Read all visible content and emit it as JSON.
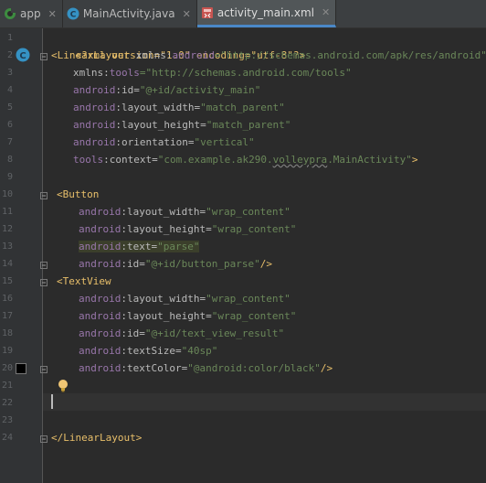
{
  "tabs": [
    {
      "label": "app",
      "icon": "android-module-icon",
      "active": false
    },
    {
      "label": "MainActivity.java",
      "icon": "class-icon",
      "active": false
    },
    {
      "label": "activity_main.xml",
      "icon": "xml-layout-icon",
      "active": true
    }
  ],
  "tab_close_glyph": "✕",
  "line_numbers": [
    "1",
    "2",
    "3",
    "4",
    "5",
    "6",
    "7",
    "8",
    "9",
    "10",
    "11",
    "12",
    "13",
    "14",
    "15",
    "16",
    "17",
    "18",
    "19",
    "20",
    "21",
    "22",
    "23",
    "24"
  ],
  "gutter_class_marker": "C",
  "code": {
    "l1": {
      "text": "<?xml version=\"1.0\" encoding=\"utf-8\"?>"
    },
    "l2": {
      "open": "<LinearLayout",
      "a1": " xmlns:",
      "a1ns": "android",
      "v1": "=\"http://schemas.android.com/apk/res/android\""
    },
    "l3": {
      "a": "xmlns:",
      "ns": "tools",
      "v": "=\"http://schemas.android.com/tools\""
    },
    "l4": {
      "ns": "android",
      "a": ":id=",
      "v": "\"@+id/activity_main\""
    },
    "l5": {
      "ns": "android",
      "a": ":layout_width=",
      "v": "\"match_parent\""
    },
    "l6": {
      "ns": "android",
      "a": ":layout_height=",
      "v": "\"match_parent\""
    },
    "l7": {
      "ns": "android",
      "a": ":orientation=",
      "v": "\"vertical\""
    },
    "l8": {
      "ns": "tools",
      "a": ":context=",
      "v1": "\"com.example.ak290.",
      "v2": "volleypra",
      "v3": ".MainActivity\"",
      "close": ">"
    },
    "l10": {
      "open": "<Button"
    },
    "l11": {
      "ns": "android",
      "a": ":layout_width=",
      "v": "\"wrap_content\""
    },
    "l12": {
      "ns": "android",
      "a": ":layout_height=",
      "v": "\"wrap_content\""
    },
    "l13": {
      "ns": "android",
      "a": ":text=",
      "v": "\"parse\""
    },
    "l14": {
      "ns": "android",
      "a": ":id=",
      "v": "\"@+id/button_parse\"",
      "close": "/>"
    },
    "l15": {
      "open": "<TextView"
    },
    "l16": {
      "ns": "android",
      "a": ":layout_width=",
      "v": "\"wrap_content\""
    },
    "l17": {
      "ns": "android",
      "a": ":layout_height=",
      "v": "\"wrap_content\""
    },
    "l18": {
      "ns": "android",
      "a": ":id=",
      "v": "\"@+id/text_view_result\""
    },
    "l19": {
      "ns": "android",
      "a": ":textSize=",
      "v": "\"40sp\""
    },
    "l20": {
      "ns": "android",
      "a": ":textColor=",
      "v": "\"@android:color/black\"",
      "close": "/>"
    },
    "l24": {
      "close": "</LinearLayout>"
    }
  },
  "colors": {
    "background": "#2b2b2b",
    "gutter": "#313335",
    "tag": "#e8bf6a",
    "namespace": "#9876aa",
    "value": "#6a8759",
    "active_tab_accent": "#4a88c7"
  }
}
